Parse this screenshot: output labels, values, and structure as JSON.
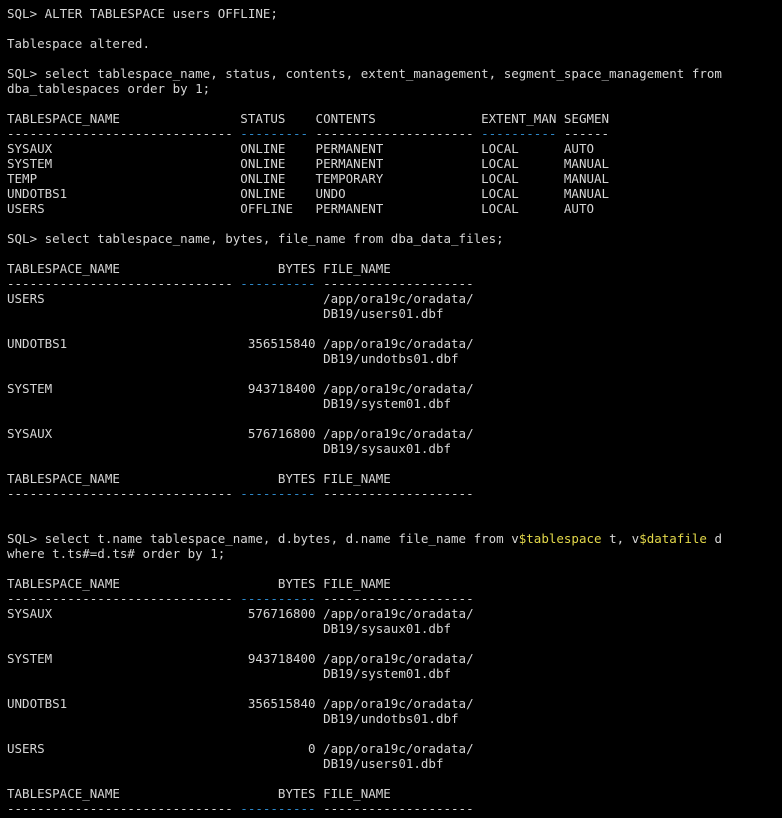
{
  "colors": {
    "background": "#000000",
    "text": "#d6d6d6",
    "blue_dashes": "#2e88c8",
    "dollar_highlight": "#e3d84a"
  },
  "terminal": {
    "lines": [
      [
        {
          "t": "SQL> ALTER TABLESPACE users OFFLINE;"
        }
      ],
      [],
      [
        {
          "t": "Tablespace altered."
        }
      ],
      [],
      [
        {
          "t": "SQL> select tablespace_name, status, contents, extent_management, segment_space_management from"
        }
      ],
      [
        {
          "t": "dba_tablespaces order by 1;"
        }
      ],
      [],
      [
        {
          "t": "TABLESPACE_NAME                STATUS    CONTENTS              EXTENT_MAN SEGMEN"
        }
      ],
      [
        {
          "t": "------------------------------ "
        },
        {
          "t": "---------",
          "c": "blue"
        },
        {
          "t": " --------------------- "
        },
        {
          "t": "----------",
          "c": "blue"
        },
        {
          "t": " ------"
        }
      ],
      [
        {
          "t": "SYSAUX                         ONLINE    PERMANENT             LOCAL      AUTO"
        }
      ],
      [
        {
          "t": "SYSTEM                         ONLINE    PERMANENT             LOCAL      MANUAL"
        }
      ],
      [
        {
          "t": "TEMP                           ONLINE    TEMPORARY             LOCAL      MANUAL"
        }
      ],
      [
        {
          "t": "UNDOTBS1                       ONLINE    UNDO                  LOCAL      MANUAL"
        }
      ],
      [
        {
          "t": "USERS                          OFFLINE   PERMANENT             LOCAL      AUTO"
        }
      ],
      [],
      [
        {
          "t": "SQL> select tablespace_name, bytes, file_name from dba_data_files;"
        }
      ],
      [],
      [
        {
          "t": "TABLESPACE_NAME                     BYTES FILE_NAME"
        }
      ],
      [
        {
          "t": "------------------------------ "
        },
        {
          "t": "----------",
          "c": "blue"
        },
        {
          "t": " --------------------"
        }
      ],
      [
        {
          "t": "USERS                                     /app/ora19c/oradata/"
        }
      ],
      [
        {
          "t": "                                          DB19/users01.dbf"
        }
      ],
      [],
      [
        {
          "t": "UNDOTBS1                        356515840 /app/ora19c/oradata/"
        }
      ],
      [
        {
          "t": "                                          DB19/undotbs01.dbf"
        }
      ],
      [],
      [
        {
          "t": "SYSTEM                          943718400 /app/ora19c/oradata/"
        }
      ],
      [
        {
          "t": "                                          DB19/system01.dbf"
        }
      ],
      [],
      [
        {
          "t": "SYSAUX                          576716800 /app/ora19c/oradata/"
        }
      ],
      [
        {
          "t": "                                          DB19/sysaux01.dbf"
        }
      ],
      [],
      [
        {
          "t": "TABLESPACE_NAME                     BYTES FILE_NAME"
        }
      ],
      [
        {
          "t": "------------------------------ "
        },
        {
          "t": "----------",
          "c": "blue"
        },
        {
          "t": " --------------------"
        }
      ],
      [],
      [],
      [
        {
          "t": "SQL> select t.name tablespace_name, d.bytes, d.name file_name from v"
        },
        {
          "t": "$tablespace",
          "c": "yellow"
        },
        {
          "t": " t, v"
        },
        {
          "t": "$datafile",
          "c": "yellow"
        },
        {
          "t": " d"
        }
      ],
      [
        {
          "t": "where t.ts#=d.ts# order by 1;"
        }
      ],
      [],
      [
        {
          "t": "TABLESPACE_NAME                     BYTES FILE_NAME"
        }
      ],
      [
        {
          "t": "------------------------------ "
        },
        {
          "t": "----------",
          "c": "blue"
        },
        {
          "t": " --------------------"
        }
      ],
      [
        {
          "t": "SYSAUX                          576716800 /app/ora19c/oradata/"
        }
      ],
      [
        {
          "t": "                                          DB19/sysaux01.dbf"
        }
      ],
      [],
      [
        {
          "t": "SYSTEM                          943718400 /app/ora19c/oradata/"
        }
      ],
      [
        {
          "t": "                                          DB19/system01.dbf"
        }
      ],
      [],
      [
        {
          "t": "UNDOTBS1                        356515840 /app/ora19c/oradata/"
        }
      ],
      [
        {
          "t": "                                          DB19/undotbs01.dbf"
        }
      ],
      [],
      [
        {
          "t": "USERS                                   0 /app/ora19c/oradata/"
        }
      ],
      [
        {
          "t": "                                          DB19/users01.dbf"
        }
      ],
      [],
      [
        {
          "t": "TABLESPACE_NAME                     BYTES FILE_NAME"
        }
      ],
      [
        {
          "t": "------------------------------ "
        },
        {
          "t": "----------",
          "c": "blue"
        },
        {
          "t": " --------------------"
        }
      ]
    ]
  }
}
